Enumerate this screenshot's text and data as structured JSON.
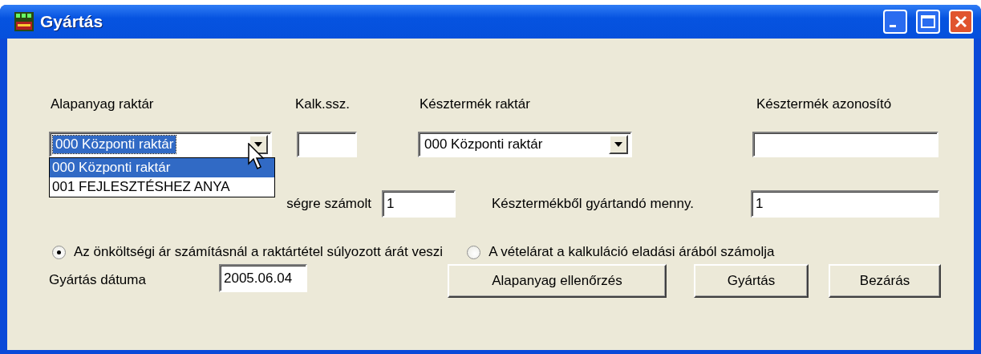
{
  "window": {
    "title": "Gyártás"
  },
  "alapanyag_raktar": {
    "label": "Alapanyag raktár",
    "value": "000 Központi raktár",
    "expanded": true,
    "options": [
      {
        "label": "000 Központi raktár",
        "selected": true
      },
      {
        "label": "001 FEJLESZTÉSHEZ ANYA",
        "selected": false
      }
    ]
  },
  "kalk_ssz": {
    "label": "Kalk.ssz."
  },
  "kesztermek_raktar": {
    "label": "Késztermék raktár",
    "value": "000 Központi raktár",
    "expanded": false
  },
  "kesztermek_azonosito": {
    "label": "Késztermék azonosító"
  },
  "kalkulacio_mennyiseg": {
    "label": "ségre számolt",
    "value": "1"
  },
  "gyartando_menny": {
    "label": "Késztermékből gyártandó menny.",
    "value": "1"
  },
  "price_options": [
    {
      "label": "Az önköltségi ár számításnál a raktártétel súlyozott árát veszi",
      "selected": true
    },
    {
      "label": "A vételárat a kalkuláció eladási árából számolja",
      "selected": false
    }
  ],
  "gyartas_datuma": {
    "label": "Gyártás dátuma",
    "value": "2005.06.04"
  },
  "buttons": [
    {
      "label": "Alapanyag ellenőrzés"
    },
    {
      "label": "Gyártás"
    },
    {
      "label": "Bezárás"
    }
  ]
}
